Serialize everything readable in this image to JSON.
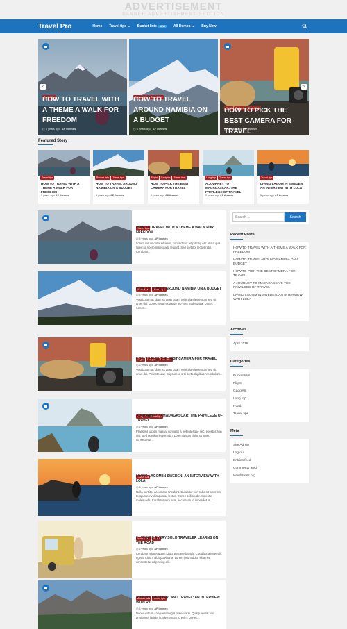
{
  "ad": {
    "title": "ADVERTISEMENT",
    "subtitle": "BANNER ADVERTISEMENT SECTION"
  },
  "nav": {
    "logo": "Travel Pro",
    "items": [
      "Home",
      "Travel tips",
      "Bucket lists",
      "All Demos",
      "Buy Now"
    ],
    "new_badge": "NEW",
    "accent": "#1e73be"
  },
  "slider": [
    {
      "cats": [
        "Travel tips"
      ],
      "title": "HOW TO TRAVEL WITH A THEME A WALK FOR FREEDOM",
      "date": "5 years ago",
      "author": "AF themes"
    },
    {
      "cats": [
        "Bucket lists",
        "Travel tips"
      ],
      "title": "HOW TO TRAVEL AROUND NAMIBIA ON A BUDGET",
      "date": "5 years ago",
      "author": "AF themes"
    },
    {
      "cats": [
        "Flight",
        "Gadgets",
        "Travel tips"
      ],
      "title": "HOW TO PICK THE BEST CAMERA FOR TRAVEL",
      "date": "5 years ago",
      "author": "AF themes"
    }
  ],
  "featured": {
    "heading": "Featured Story",
    "cards": [
      {
        "cats": [
          "Travel tips"
        ],
        "title": "HOW TO TRAVEL WITH A THEME A WALK FOR FREEDOM",
        "date": "5 years ago",
        "author": "AF themes"
      },
      {
        "cats": [
          "Bucket lists",
          "Travel tips"
        ],
        "title": "HOW TO TRAVEL AROUND NAMIBIA ON A BUDGET",
        "date": "5 years ago",
        "author": "AF themes"
      },
      {
        "cats": [
          "Flight",
          "Gadgets",
          "Travel tips"
        ],
        "title": "HOW TO PICK THE BEST CAMERA FOR TRAVEL",
        "date": "5 years ago",
        "author": "AF themes"
      },
      {
        "cats": [
          "Long trip",
          "Travel tips"
        ],
        "title": "A JOURNEY TO MADAGASCAR: THE PRIVILEGE OF TRAVEL",
        "date": "5 years ago",
        "author": "AF themes"
      },
      {
        "cats": [
          "Travel tips"
        ],
        "title": "LIVING LAGOM IN SWEDEN: AN INTERVIEW WITH LOLA",
        "date": "5 years ago",
        "author": "AF themes"
      }
    ]
  },
  "posts": [
    {
      "cats": [
        "Travel tips"
      ],
      "title": "HOW TO TRAVEL WITH A THEME A WALK FOR FREEDOM",
      "date": "5 years ago",
      "author": "AF themes",
      "excerpt": "Lorem ipsum dolor sit amet, consectetur adipiscing elit. Nulla quis lorem ut libero malesuada feugiat. Sed porttitor lectus nibh. Curabitur..."
    },
    {
      "cats": [
        "Bucket lists",
        "Travel tips"
      ],
      "title": "HOW TO TRAVEL AROUND NAMIBIA ON A BUDGET",
      "date": "5 years ago",
      "author": "AF themes",
      "excerpt": "Vestibulum ac diam sit amet quam vehicula elementum sed sit amet dui. Donec rutrum congue leo eget malesuada. Donec rutrum..."
    },
    {
      "cats": [
        "Flight",
        "Gadgets",
        "Travel tips"
      ],
      "title": "HOW TO PICK THE BEST CAMERA FOR TRAVEL",
      "date": "5 years ago",
      "author": "AF themes",
      "excerpt": "Vestibulum ac diam sit amet quam vehicula elementum sed sit amet dui. Pellentesque in ipsum id orci porta dapibus. Vestibulum..."
    },
    {
      "cats": [
        "Long trip",
        "Travel tips"
      ],
      "title": "A JOURNEY TO MADAGASCAR: THE PRIVILEGE OF TRAVEL",
      "date": "5 years ago",
      "author": "AF themes",
      "excerpt": "Praesent sapien massa, convallis a pellentesque nec, egestas non nisi. Sed porttitor lectus nibh. Lorem ipsum dolor sit amet, consectetur..."
    },
    {
      "cats": [
        "Travel tips"
      ],
      "title": "LIVING LAGOM IN SWEDEN: AN INTERVIEW WITH LOLA",
      "date": "5 years ago",
      "author": "AF themes",
      "excerpt": "Nulla porttitor accumsan tincidunt. Curabitur non nulla sit amet nisl tempus convallis quis ac lectus. Donec sollicitudin molestie malesuada. Curabitur arcu erat, accumsan id imperdiet et..."
    },
    {
      "cats": [
        "Bucket lists",
        "Road"
      ],
      "title": "24 THINGS EVERY SOLO TRAVELER LEARNS ON THE ROAD",
      "date": "5 years ago",
      "author": "AF themes",
      "excerpt": "Curabitur aliquet quam id dui posuere blandit. Curabitur aliquet elit, eget tincidunt nibh pulvinar a. Lorem ipsum dolor sit amet, consectetur adipiscing elit."
    },
    {
      "cats": [
        "Bucket lists",
        "Travel tips"
      ],
      "title": "ADVENTURE OVERLAND TRAVEL: AN INTERVIEW WITH RIC",
      "date": "5 years ago",
      "author": "AF themes",
      "excerpt": "Donec rutrum congue leo eget malesuada. Quisque velit nisi, pretium ut lacinia in, elementum id enim. Donec..."
    }
  ],
  "sidebar": {
    "search": {
      "placeholder": "Search ...",
      "button": "Search"
    },
    "recent": {
      "heading": "Recent Posts",
      "items": [
        "HOW TO TRAVEL WITH A THEME A WALK FOR FREEDOM",
        "HOW TO TRAVEL AROUND NAMIBIA ON A BUDGET",
        "HOW TO PICK THE BEST CAMERA FOR TRAVEL",
        "A JOURNEY TO MADAGASCAR: THE PRIVILEGE OF TRAVEL",
        "LIVING LAGOM IN SWEDEN: AN INTERVIEW WITH LOLA"
      ]
    },
    "archives": {
      "heading": "Archives",
      "items": [
        "April 2018"
      ]
    },
    "categories": {
      "heading": "Categories",
      "items": [
        "Bucket lists",
        "Flight",
        "Gadgets",
        "Long trip",
        "Road",
        "Travel tips"
      ]
    },
    "meta": {
      "heading": "Meta",
      "items": [
        "Site Admin",
        "Log out",
        "Entries feed",
        "Comments feed",
        "WordPress.org"
      ]
    }
  },
  "icons": {
    "search": "search-icon",
    "video": "video-camera-icon",
    "prev": "chevron-left-icon",
    "next": "chevron-right-icon",
    "clock": "clock-icon",
    "author": "user-icon"
  },
  "colors": {
    "category_badge": "#b71c1c",
    "accent": "#1e73be"
  }
}
